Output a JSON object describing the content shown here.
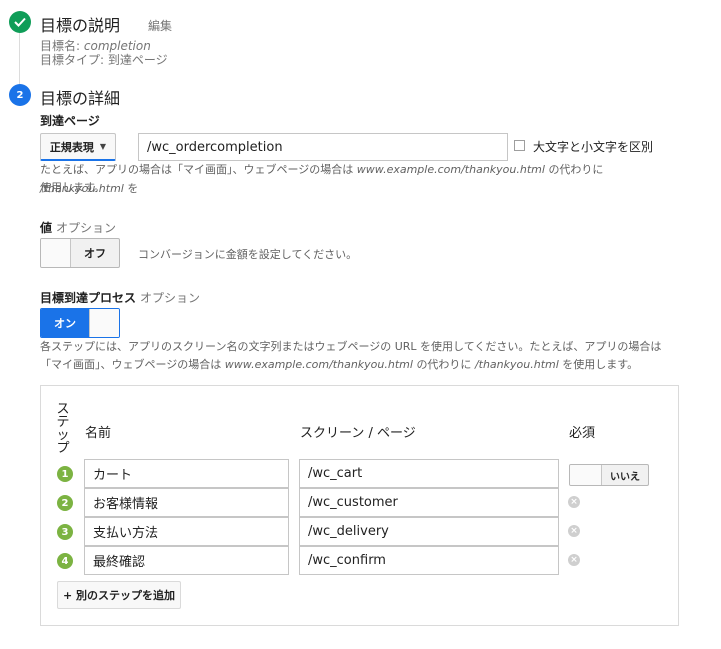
{
  "goal_description": {
    "title": "目標の説明",
    "edit": "編集",
    "name_label": "目標名:",
    "name_value": "completion",
    "type_label": "目標タイプ:",
    "type_value": "到達ページ"
  },
  "goal_details": {
    "step_number": "2",
    "title": "目標の詳細",
    "destination_label": "到達ページ",
    "match_type": "正規表現",
    "destination_value": "/wc_ordercompletion",
    "case_sensitive_label": "大文字と小文字を区別",
    "help_p1": "たとえば、アプリの場合は「マイ画面」、ウェブページの場合は",
    "help_example_url": "www.example.com/thankyou.html",
    "help_p2": "の代わりに",
    "help_example_path": "/thankyou.html",
    "help_p3": "を",
    "help_line2": "使用します。"
  },
  "value": {
    "label": "値",
    "optional": "オプション",
    "toggle_label": "オフ",
    "help": "コンバージョンに金額を設定してください。"
  },
  "funnel": {
    "label": "目標到達プロセス",
    "optional": "オプション",
    "toggle_label": "オン",
    "help_l1_a": "各ステップには、アプリのスクリーン名の文字列またはウェブページの URL を使用してください。たとえば、アプリの場合は",
    "help_l2_a": "「マイ画面」、ウェブページの場合は",
    "help_example_url": "www.example.com/thankyou.html",
    "help_l2_b": "の代わりに",
    "help_example_path": "/thankyou.html",
    "help_l2_c": "を使用します。",
    "columns": {
      "step": [
        "ス",
        "テ",
        "ッ",
        "プ"
      ],
      "name": "名前",
      "screen": "スクリーン / ページ",
      "required": "必須"
    },
    "steps": [
      {
        "num": "1",
        "name": "カート",
        "screen": "/wc_cart"
      },
      {
        "num": "2",
        "name": "お客様情報",
        "screen": "/wc_customer"
      },
      {
        "num": "3",
        "name": "支払い方法",
        "screen": "/wc_delivery"
      },
      {
        "num": "4",
        "name": "最終確認",
        "screen": "/wc_confirm"
      }
    ],
    "required_toggle": "いいえ",
    "add_step": "+ 別のステップを追加"
  },
  "colors": {
    "primary_blue": "#1a73e8",
    "success_green": "#0f9d58",
    "step_green": "#7cb342"
  }
}
